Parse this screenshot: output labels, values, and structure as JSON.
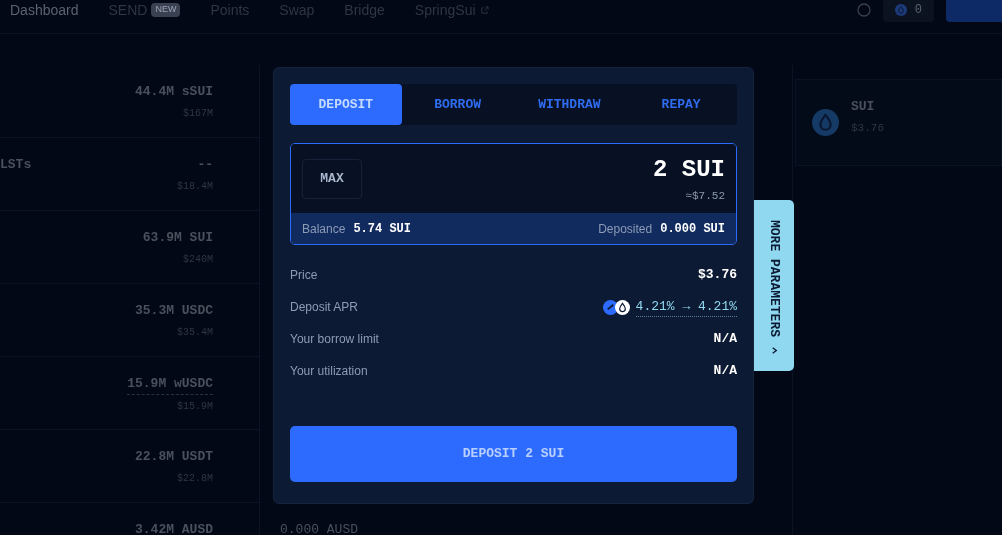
{
  "nav": {
    "items": [
      {
        "label": "Dashboard",
        "selected": true
      },
      {
        "label": "SEND",
        "selected": false,
        "badge": "NEW"
      },
      {
        "label": "Points",
        "selected": false
      },
      {
        "label": "Swap",
        "selected": false
      },
      {
        "label": "Bridge",
        "selected": false
      },
      {
        "label": "SpringSui",
        "selected": false,
        "external": true
      }
    ],
    "points": "0"
  },
  "table": {
    "rows": [
      {
        "label": "",
        "amount": "44.4M sSUI",
        "usd": "$167M"
      },
      {
        "label": "LSTs",
        "amount": "--",
        "usd": "$18.4M"
      },
      {
        "label": "",
        "amount": "63.9M SUI",
        "usd": "$240M"
      },
      {
        "label": "",
        "amount": "35.3M USDC",
        "usd": "$35.4M"
      },
      {
        "label": "",
        "amount": "15.9M wUSDC",
        "usd": "$15.9M",
        "underlined": true
      },
      {
        "label": "",
        "amount": "22.8M USDT",
        "usd": "$22.8M"
      },
      {
        "label": "",
        "amount": "3.42M AUSD",
        "usd": "",
        "extra": "0.000 AUSD"
      }
    ]
  },
  "asset_card": {
    "symbol": "SUI",
    "price": "$3.76"
  },
  "modal": {
    "tabs": [
      {
        "label": "DEPOSIT",
        "selected": true
      },
      {
        "label": "BORROW",
        "selected": false
      },
      {
        "label": "WITHDRAW",
        "selected": false
      },
      {
        "label": "REPAY",
        "selected": false
      }
    ],
    "max_label": "MAX",
    "amount": "2 SUI",
    "amount_usd": "≈$7.52",
    "balance_label": "Balance",
    "balance": "5.74 SUI",
    "deposited_label": "Deposited",
    "deposited": "0.000 SUI",
    "stats": [
      {
        "label": "Price",
        "value": "$3.76",
        "kind": "plain"
      },
      {
        "label": "Deposit APR",
        "value": "4.21% → 4.21%",
        "kind": "apr"
      },
      {
        "label": "Your borrow limit",
        "value": "N/A",
        "kind": "plain"
      },
      {
        "label": "Your utilization",
        "value": "N/A",
        "kind": "plain"
      }
    ],
    "submit": "DEPOSIT 2 SUI",
    "side_tab": "MORE PARAMETERS"
  }
}
